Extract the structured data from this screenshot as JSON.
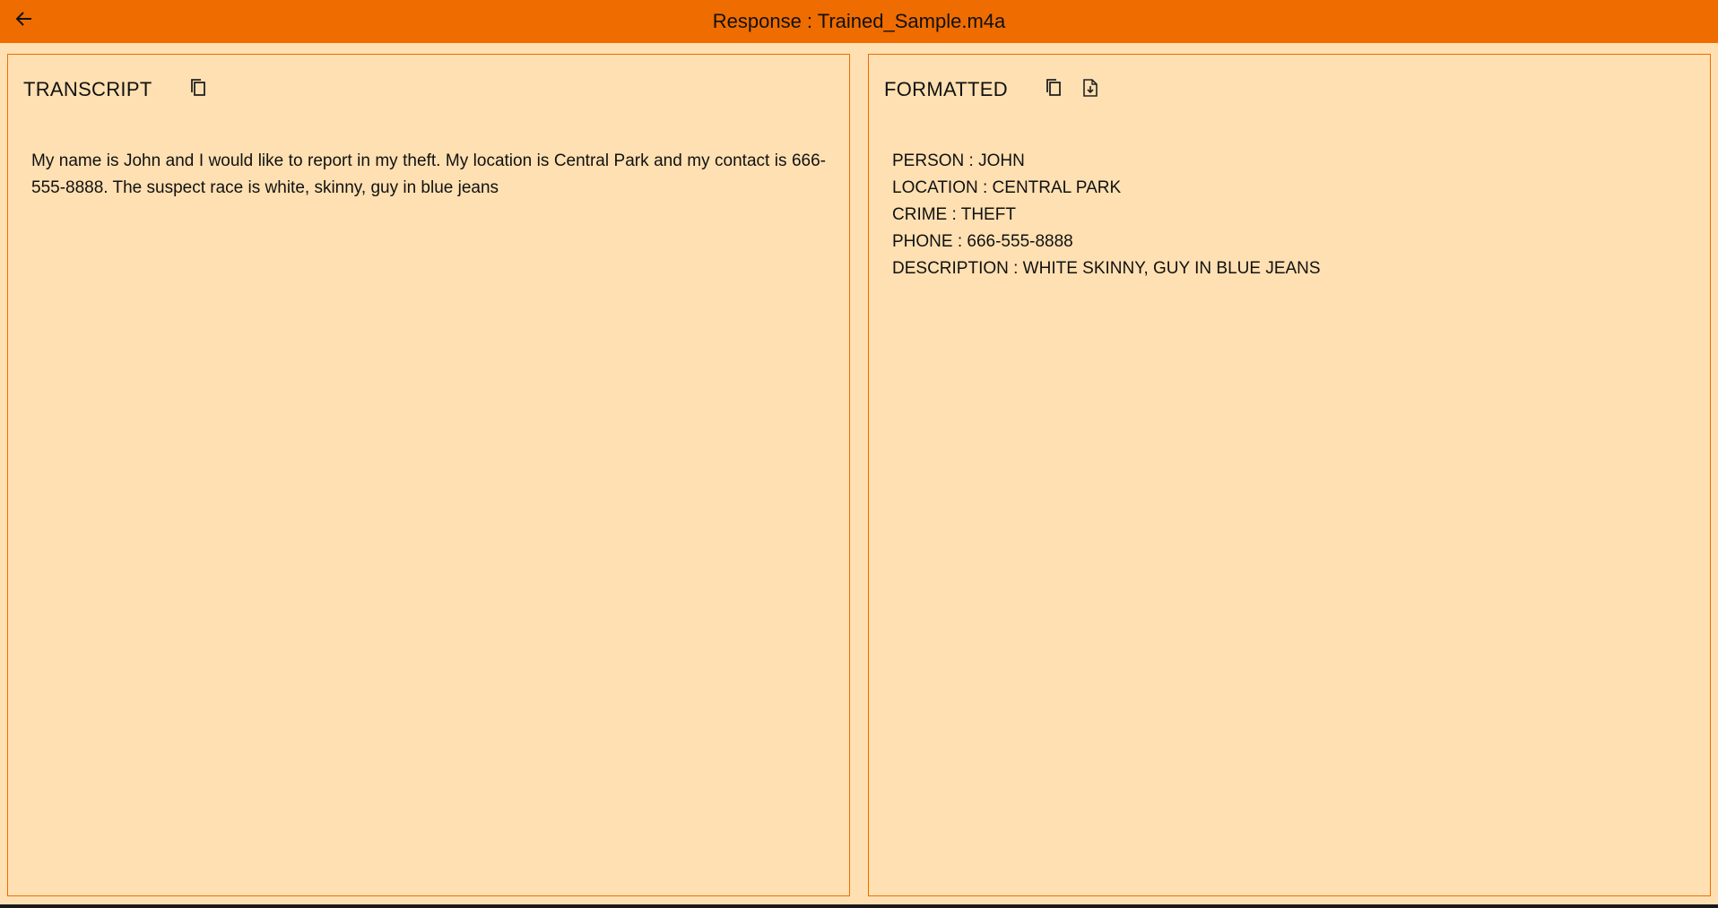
{
  "header": {
    "title": "Response : Trained_Sample.m4a",
    "back_icon": "arrow-left-icon"
  },
  "transcript_panel": {
    "heading": "TRANSCRIPT",
    "copy_icon": "copy-icon",
    "text": "My name is John and I would like to report in my theft. My location is Central Park and my contact is 666-555-8888. The suspect race is white, skinny, guy in blue jeans"
  },
  "formatted_panel": {
    "heading": "FORMATTED",
    "copy_icon": "copy-icon",
    "save_icon": "save-file-icon",
    "lines": [
      "PERSON : JOHN",
      "LOCATION : CENTRAL PARK",
      "CRIME : THEFT",
      "PHONE : 666-555-8888",
      "DESCRIPTION : WHITE SKINNY, GUY IN BLUE JEANS"
    ]
  },
  "colors": {
    "accent": "#ef6c00",
    "background": "#ffe0b2",
    "text": "#111111"
  }
}
